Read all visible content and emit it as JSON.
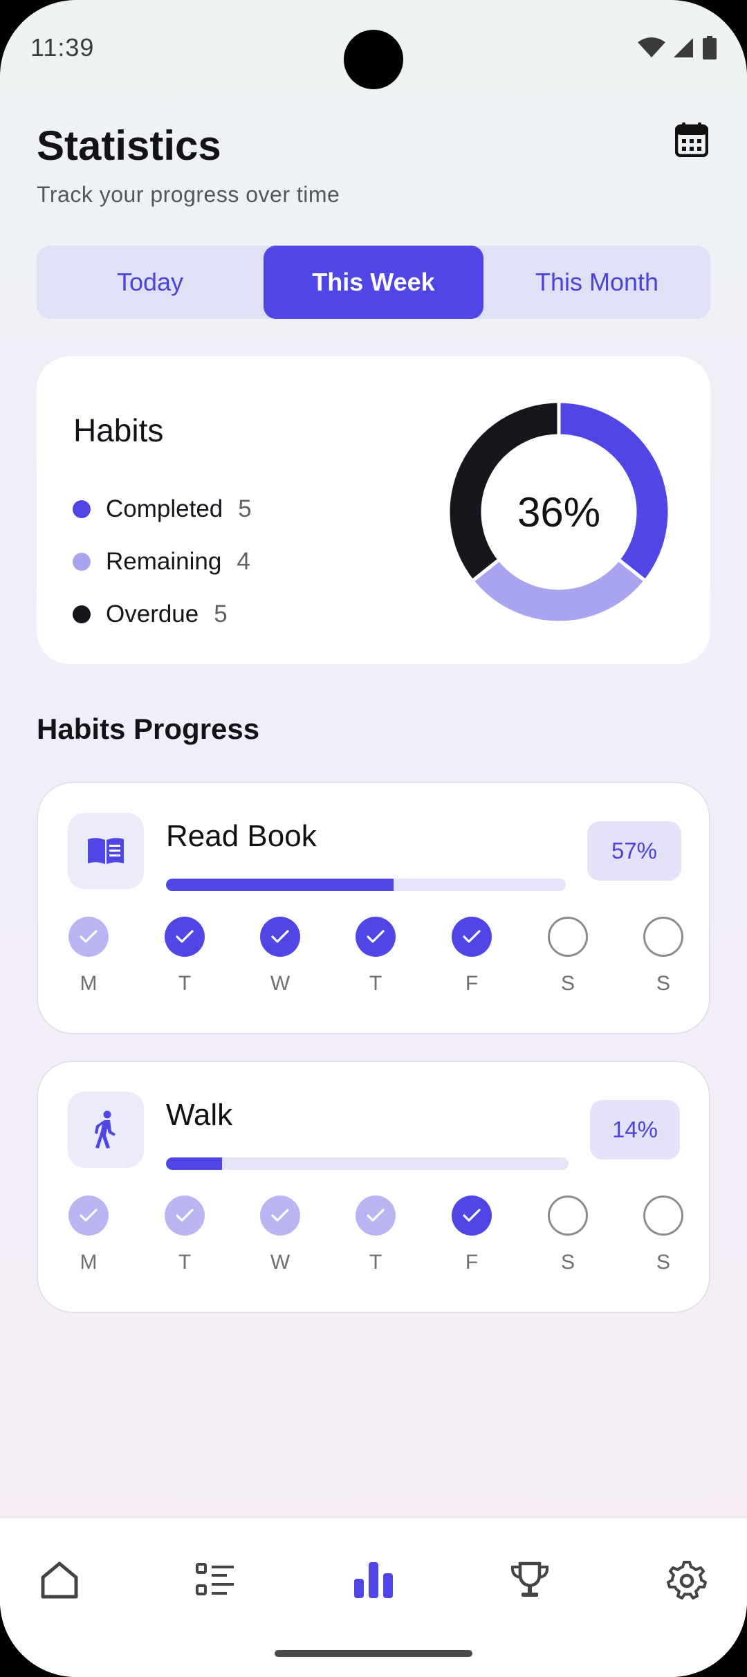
{
  "status_bar": {
    "time": "11:39",
    "icons": [
      "wifi-icon",
      "signal-icon",
      "battery-icon"
    ]
  },
  "header": {
    "title": "Statistics",
    "subtitle": "Track your progress over time",
    "calendar_icon": "calendar-icon"
  },
  "period_tabs": [
    {
      "label": "Today",
      "selected": false
    },
    {
      "label": "This Week",
      "selected": true
    },
    {
      "label": "This Month",
      "selected": false
    }
  ],
  "habits_summary": {
    "title": "Habits",
    "percent_label": "36%",
    "legend": [
      {
        "label": "Completed",
        "value": "5",
        "color": "#4f46e5"
      },
      {
        "label": "Remaining",
        "value": "4",
        "color": "#a9a4f0"
      },
      {
        "label": "Overdue",
        "value": "5",
        "color": "#16161c"
      }
    ]
  },
  "progress_section": {
    "title": "Habits Progress",
    "habits": [
      {
        "name": "Read Book",
        "icon": "book-icon",
        "percent_label": "57%",
        "progress": 0.57,
        "days": [
          {
            "label": "M",
            "state": "partial"
          },
          {
            "label": "T",
            "state": "done"
          },
          {
            "label": "W",
            "state": "done"
          },
          {
            "label": "T",
            "state": "done"
          },
          {
            "label": "F",
            "state": "done"
          },
          {
            "label": "S",
            "state": "empty"
          },
          {
            "label": "S",
            "state": "empty"
          }
        ]
      },
      {
        "name": "Walk",
        "icon": "walk-icon",
        "percent_label": "14%",
        "progress": 0.14,
        "days": [
          {
            "label": "M",
            "state": "partial"
          },
          {
            "label": "T",
            "state": "partial"
          },
          {
            "label": "W",
            "state": "partial"
          },
          {
            "label": "T",
            "state": "partial"
          },
          {
            "label": "F",
            "state": "done"
          },
          {
            "label": "S",
            "state": "empty"
          },
          {
            "label": "S",
            "state": "empty"
          }
        ]
      }
    ]
  },
  "bottom_nav": {
    "items": [
      {
        "icon": "home-icon",
        "active": false
      },
      {
        "icon": "list-icon",
        "active": false
      },
      {
        "icon": "bar-chart-icon",
        "active": true
      },
      {
        "icon": "trophy-icon",
        "active": false
      },
      {
        "icon": "settings-icon",
        "active": false
      }
    ]
  },
  "colors": {
    "accent": "#4f46e5",
    "accent_light": "#a9a4f0",
    "dark": "#16161c"
  }
}
